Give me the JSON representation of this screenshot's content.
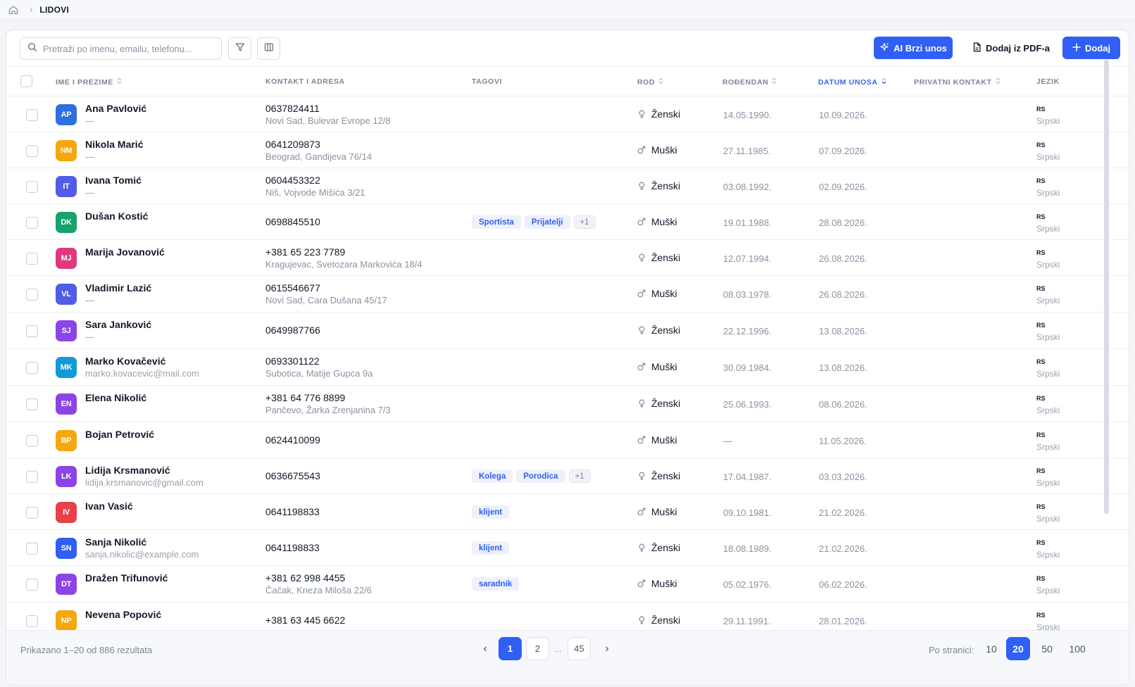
{
  "breadcrumb": {
    "current": "LIDOVI"
  },
  "toolbar": {
    "search_placeholder": "Pretraži po imenu, emailu, telefonu...",
    "ai_label": "AI Brzi unos",
    "pdf_label": "Dodaj iz PDF-a",
    "add_label": "Dodaj"
  },
  "columns": {
    "name": "IME I PREZIME",
    "contact": "KONTAKT I ADRESA",
    "tags": "TAGOVI",
    "gender": "ROD",
    "birthday": "ROĐENDAN",
    "entry_date": "DATUM UNOSA",
    "private_contact": "PRIVATNI KONTAKT",
    "language": "JEZIK"
  },
  "rows": [
    {
      "initials": "AP",
      "color": "#2f6fe0",
      "name": "Ana Pavlović",
      "sub": "—",
      "phone": "0637824411",
      "address": "Novi Sad, Bulevar Evrope 12/8",
      "tags": [],
      "gender": "Ženski",
      "gender_icon": "female-icon",
      "birthday": "14.05.1990.",
      "entry": "10.09.2026.",
      "lang_code": "RS",
      "lang_name": "Srpski"
    },
    {
      "initials": "NM",
      "color": "#f5a70c",
      "name": "Nikola Marić",
      "sub": "—",
      "phone": "0641209873",
      "address": "Beograd, Gandijeva 76/14",
      "tags": [],
      "gender": "Muški",
      "gender_icon": "male-icon",
      "birthday": "27.11.1985.",
      "entry": "07.09.2026.",
      "lang_code": "RS",
      "lang_name": "Srpski"
    },
    {
      "initials": "IT",
      "color": "#4f5de8",
      "name": "Ivana Tomić",
      "sub": "—",
      "phone": "0604453322",
      "address": "Niš, Vojvode Mišića 3/21",
      "tags": [],
      "gender": "Ženski",
      "gender_icon": "female-icon",
      "birthday": "03.08.1992.",
      "entry": "02.09.2026.",
      "lang_code": "RS",
      "lang_name": "Srpski"
    },
    {
      "initials": "DK",
      "color": "#16a36c",
      "name": "Dušan Kostić",
      "sub": "",
      "phone": "0698845510",
      "address": "",
      "tags": [
        "Sportista",
        "Prijatelji"
      ],
      "tag_more": "+1",
      "gender": "Muški",
      "gender_icon": "male-icon",
      "birthday": "19.01.1988.",
      "entry": "28.08.2026.",
      "lang_code": "RS",
      "lang_name": "Srpski"
    },
    {
      "initials": "MJ",
      "color": "#e0377f",
      "name": "Marija Jovanović",
      "sub": "",
      "phone": "+381 65 223 7789",
      "address": "Kragujevac, Svetozara Markovića 18/4",
      "tags": [],
      "gender": "Ženski",
      "gender_icon": "female-icon",
      "birthday": "12.07.1994.",
      "entry": "26.08.2026.",
      "lang_code": "RS",
      "lang_name": "Srpski"
    },
    {
      "initials": "VL",
      "color": "#4f5de8",
      "name": "Vladimir Lazić",
      "sub": "—",
      "phone": "0615546677",
      "address": "Novi Sad, Cara Dušana 45/17",
      "tags": [],
      "gender": "Muški",
      "gender_icon": "male-icon",
      "birthday": "08.03.1978.",
      "entry": "26.08.2026.",
      "lang_code": "RS",
      "lang_name": "Srpski"
    },
    {
      "initials": "SJ",
      "color": "#8b45e6",
      "name": "Sara Janković",
      "sub": "—",
      "phone": "0649987766",
      "address": "",
      "tags": [],
      "gender": "Ženski",
      "gender_icon": "female-icon",
      "birthday": "22.12.1996.",
      "entry": "13.08.2026.",
      "lang_code": "RS",
      "lang_name": "Srpski"
    },
    {
      "initials": "MK",
      "color": "#129ad8",
      "name": "Marko Kovačević",
      "sub": "marko.kovacevic@mail.com",
      "phone": "0693301122",
      "address": "Subotica, Matije Gupca 9a",
      "tags": [],
      "gender": "Muški",
      "gender_icon": "male-icon",
      "birthday": "30.09.1984.",
      "entry": "13.08.2026.",
      "lang_code": "RS",
      "lang_name": "Srpski"
    },
    {
      "initials": "EN",
      "color": "#8b45e6",
      "name": "Elena Nikolić",
      "sub": "",
      "phone": "+381 64 776 8899",
      "address": "Pančevo, Žarka Zrenjanina 7/3",
      "tags": [],
      "gender": "Ženski",
      "gender_icon": "female-icon",
      "birthday": "25.06.1993.",
      "entry": "08.06.2026.",
      "lang_code": "RS",
      "lang_name": "Srpski"
    },
    {
      "initials": "BP",
      "color": "#f5a70c",
      "name": "Bojan Petrović",
      "sub": "",
      "phone": "0624410099",
      "address": "",
      "tags": [],
      "gender": "Muški",
      "gender_icon": "male-icon",
      "birthday": "—",
      "entry": "11.05.2026.",
      "lang_code": "RS",
      "lang_name": "Srpski"
    },
    {
      "initials": "LK",
      "color": "#8b45e6",
      "name": "Lidija Krsmanović",
      "sub": "lidija.krsmanovic@gmail.com",
      "phone": "0636675543",
      "address": "",
      "tags": [
        "Kolega",
        "Porodica"
      ],
      "tag_more": "+1",
      "gender": "Ženski",
      "gender_icon": "female-icon",
      "birthday": "17.04.1987.",
      "entry": "03.03.2026.",
      "lang_code": "RS",
      "lang_name": "Srpski"
    },
    {
      "initials": "IV",
      "color": "#e8414a",
      "name": "Ivan Vasić",
      "sub": "",
      "phone": "0641198833",
      "address": "",
      "tags": [
        "klijent"
      ],
      "gender": "Muški",
      "gender_icon": "male-icon",
      "birthday": "09.10.1981.",
      "entry": "21.02.2026.",
      "lang_code": "RS",
      "lang_name": "Srpski"
    },
    {
      "initials": "SN",
      "color": "#2f5ff5",
      "name": "Sanja Nikolić",
      "sub": "sanja.nikolic@example.com",
      "phone": "0641198833",
      "address": "",
      "tags": [
        "klijent"
      ],
      "gender": "Ženski",
      "gender_icon": "female-icon",
      "birthday": "18.08.1989.",
      "entry": "21.02.2026.",
      "lang_code": "RS",
      "lang_name": "Srpski"
    },
    {
      "initials": "DT",
      "color": "#8b45e6",
      "name": "Dražen Trifunović",
      "sub": "",
      "phone": "+381 62 998 4455",
      "address": "Čačak, Kneza Miloša 22/6",
      "tags": [
        "saradnik"
      ],
      "gender": "Muški",
      "gender_icon": "male-icon",
      "birthday": "05.02.1976.",
      "entry": "06.02.2026.",
      "lang_code": "RS",
      "lang_name": "Srpski"
    },
    {
      "initials": "NP",
      "color": "#f5a70c",
      "name": "Nevena Popović",
      "sub": "",
      "phone": "+381 63 445 6622",
      "address": "",
      "tags": [],
      "gender": "Ženski",
      "gender_icon": "female-icon",
      "birthday": "29.11.1991.",
      "entry": "28.01.2026.",
      "lang_code": "RS",
      "lang_name": "Srpski"
    }
  ],
  "footer": {
    "result_text": "Prikazano 1–20 od 886 rezultata",
    "pages": [
      "1",
      "2",
      "45"
    ],
    "current_page": "1",
    "ellipsis": "...",
    "per_page_label": "Po stranici:",
    "per_page_options": [
      "10",
      "20",
      "50",
      "100"
    ],
    "per_page_selected": "20"
  },
  "colors": {
    "accent": "#2f5ff5",
    "active_sort": "#3b63e8"
  }
}
